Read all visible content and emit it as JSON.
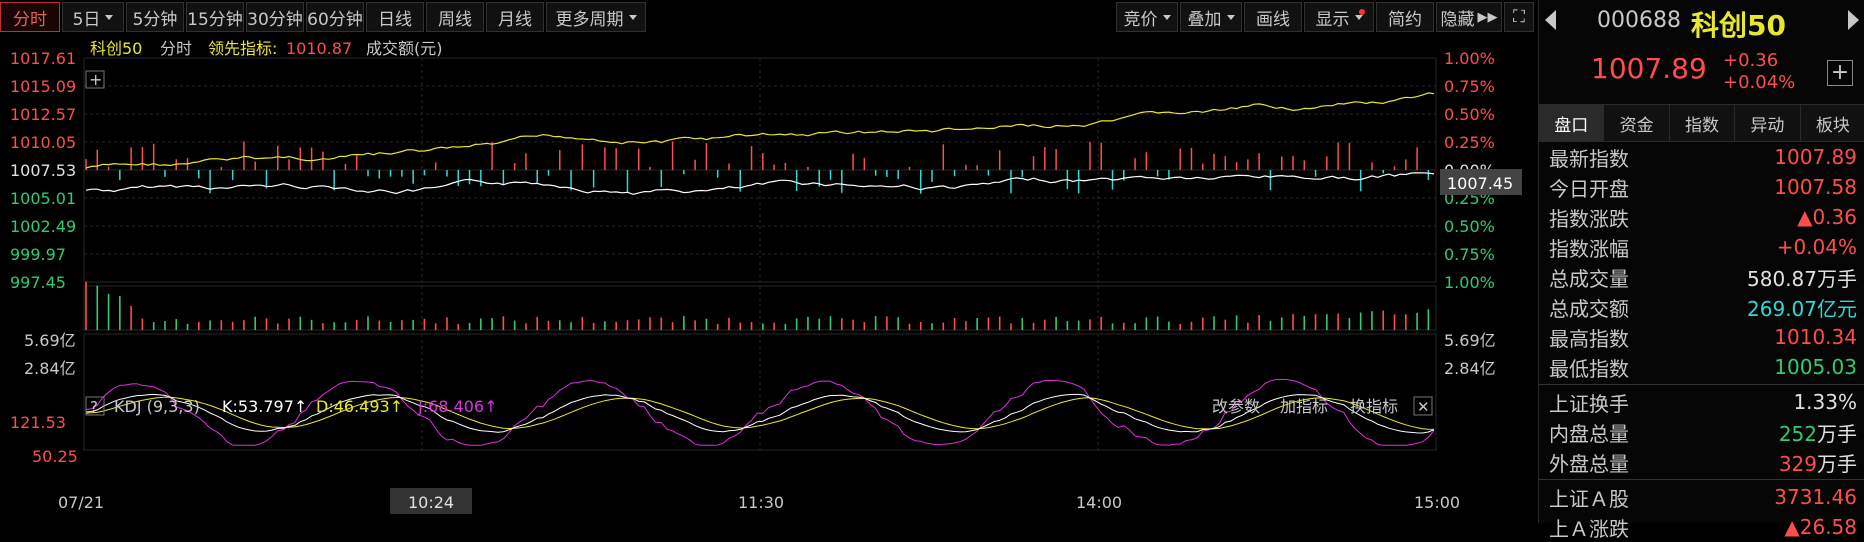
{
  "colors": {
    "up": "#ff4d4d",
    "down": "#2ecc71",
    "yellow": "#e8e82a",
    "cyan": "#30d8d8",
    "magenta": "#e030e0",
    "grid": "#262626"
  },
  "toolbar": {
    "tabs": [
      "分时",
      "5日",
      "5分钟",
      "15分钟",
      "30分钟",
      "60分钟",
      "日线",
      "周线",
      "月线",
      "更多周期"
    ],
    "right": [
      "竞价",
      "叠加",
      "画线",
      "显示",
      "简约",
      "隐藏"
    ],
    "icons": [
      "chevron-right-double-icon",
      "fullscreen-icon"
    ]
  },
  "legend": {
    "name": "科创50",
    "mode": "分时",
    "lead_label": "领先指标:",
    "lead_value": "1010.87",
    "volume_label": "成交额(元)"
  },
  "price_axis": {
    "left": [
      "1017.61",
      "1015.09",
      "1012.57",
      "1010.05",
      "1007.53",
      "1005.01",
      "1002.49",
      "999.97",
      "997.45"
    ],
    "right": [
      "1.00%",
      "0.75%",
      "0.50%",
      "0.25%",
      "0.00%",
      "0.25%",
      "0.50%",
      "0.75%",
      "1.00%"
    ],
    "current_tag": "1007.45"
  },
  "volume_axis": {
    "left": [
      "5.69亿",
      "2.84亿"
    ],
    "right": [
      "5.69亿",
      "2.84亿"
    ]
  },
  "kdj": {
    "help": "?",
    "title": "KDJ (9,3,3)",
    "k": "K:53.797↑",
    "d": "D:46.493↑",
    "j": "J:68.406↑",
    "actions": [
      "改参数",
      "加指标",
      "换指标"
    ],
    "axis": [
      "121.53",
      "50.25"
    ]
  },
  "time_axis": {
    "labels": [
      "07/21",
      "10:24",
      "11:30",
      "14:00",
      "15:00"
    ]
  },
  "quote": {
    "code": "000688",
    "name": "科创50",
    "price": "1007.89",
    "change": "+0.36",
    "change_pct": "+0.04%",
    "add_icon": "plus-icon"
  },
  "tabs": [
    "盘口",
    "资金",
    "指数",
    "异动",
    "板块"
  ],
  "stats": [
    {
      "label": "最新指数",
      "value": "1007.89",
      "unit": "",
      "color": "#ff4d4d"
    },
    {
      "label": "今日开盘",
      "value": "1007.58",
      "unit": "",
      "color": "#ff4d4d"
    },
    {
      "label": "指数涨跌",
      "value": "▲0.36",
      "unit": "",
      "color": "#ff4d4d"
    },
    {
      "label": "指数涨幅",
      "value": "+0.04%",
      "unit": "",
      "color": "#ff4d4d"
    },
    {
      "label": "总成交量",
      "value": "580.87",
      "unit": "万手",
      "color": "#e0e0e0"
    },
    {
      "label": "总成交额",
      "value": "269.07",
      "unit": "亿元",
      "color": "#30d8d8"
    },
    {
      "label": "最高指数",
      "value": "1010.34",
      "unit": "",
      "color": "#ff4d4d"
    },
    {
      "label": "最低指数",
      "value": "1005.03",
      "unit": "",
      "color": "#2ecc71"
    }
  ],
  "stats2": [
    {
      "label": "上证换手",
      "value": "1.33%",
      "unit": "",
      "color": "#e0e0e0"
    },
    {
      "label": "内盘总量",
      "value": "252",
      "unit": "万手",
      "color": "#2ecc71"
    },
    {
      "label": "外盘总量",
      "value": "329",
      "unit": "万手",
      "color": "#ff4d4d"
    }
  ],
  "stats3": [
    {
      "label": "上证Ａ股",
      "value": "3731.46",
      "unit": "",
      "color": "#ff4d4d"
    },
    {
      "label": "上Ａ涨跌",
      "value": "▲26.58",
      "unit": "",
      "color": "#ff4d4d"
    }
  ]
}
